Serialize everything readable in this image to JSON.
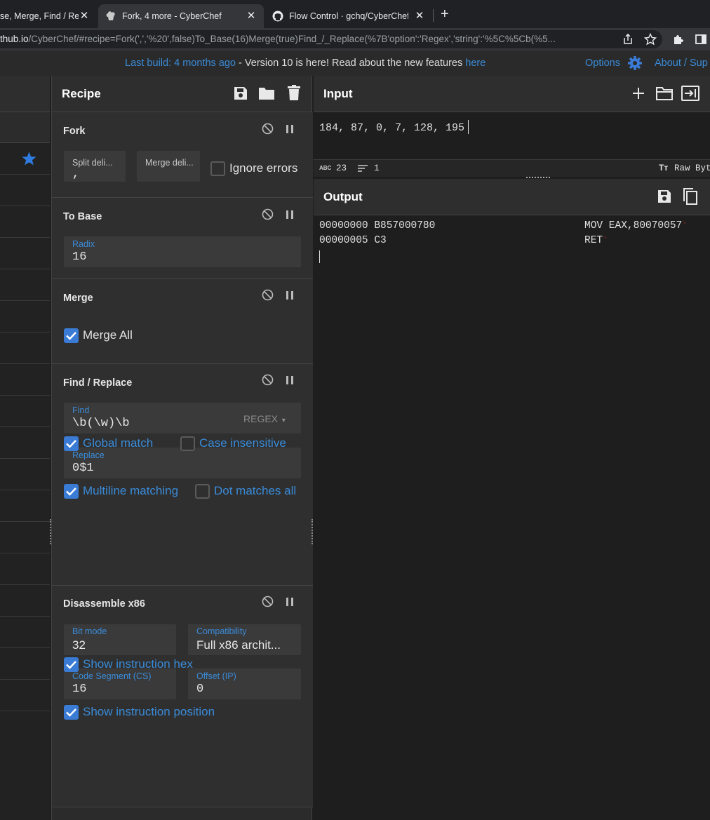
{
  "browser": {
    "tabs": [
      {
        "title": "se, Merge, Find / Re",
        "active": false
      },
      {
        "title": "Fork, 4 more - CyberChef",
        "active": true
      },
      {
        "title": "Flow Control · gchq/CyberChef",
        "active": false
      }
    ],
    "url_host": "thub.io",
    "url_rest": "/CyberChef/#recipe=Fork(',','%20',false)To_Base(16)Merge(true)Find_/_Replace(%7B'option':'Regex','string':'%5C%5Cb(%5..."
  },
  "banner": {
    "link_last_build": "Last build: 4 months ago",
    "message": " - Version 10 is here! Read about the new features ",
    "link_here": "here",
    "options": "Options",
    "about": "About / Sup"
  },
  "recipe": {
    "title": "Recipe",
    "fork": {
      "title": "Fork",
      "split_label": "Split deli...",
      "split_value": ",",
      "merge_label": "Merge deli...",
      "ignore_errors": "Ignore errors"
    },
    "to_base": {
      "title": "To Base",
      "radix_label": "Radix",
      "radix_value": "16"
    },
    "merge": {
      "title": "Merge",
      "merge_all": "Merge All"
    },
    "find_replace": {
      "title": "Find / Replace",
      "find_label": "Find",
      "find_value": "\\b(\\w)\\b",
      "find_mode": "REGEX",
      "replace_label": "Replace",
      "replace_value": "0$1",
      "global_match": "Global match",
      "case_insensitive": "Case insensitive",
      "multiline": "Multiline matching",
      "dot_matches_all": "Dot matches all"
    },
    "disassemble": {
      "title": "Disassemble x86",
      "bit_mode_label": "Bit mode",
      "bit_mode_value": "32",
      "compat_label": "Compatibility",
      "compat_value": "Full x86 archit...",
      "cs_label": "Code Segment (CS)",
      "cs_value": "16",
      "ip_label": "Offset (IP)",
      "ip_value": "0",
      "show_hex": "Show instruction hex",
      "show_pos": "Show instruction position"
    }
  },
  "input": {
    "title": "Input",
    "text": "184, 87, 0, 7, 128, 195",
    "length": "23",
    "lines": "1",
    "raw_bytes": "Raw Byt"
  },
  "output": {
    "title": "Output",
    "lines": [
      {
        "addr_hex": "00000000 B857000780",
        "asm": "MOV EAX,80070057"
      },
      {
        "addr_hex": "00000005 C3",
        "asm": "RET"
      }
    ]
  },
  "colors": {
    "accent": "#3a8bd8",
    "checkbox": "#3a7bd5",
    "star": "#2f7be0"
  }
}
